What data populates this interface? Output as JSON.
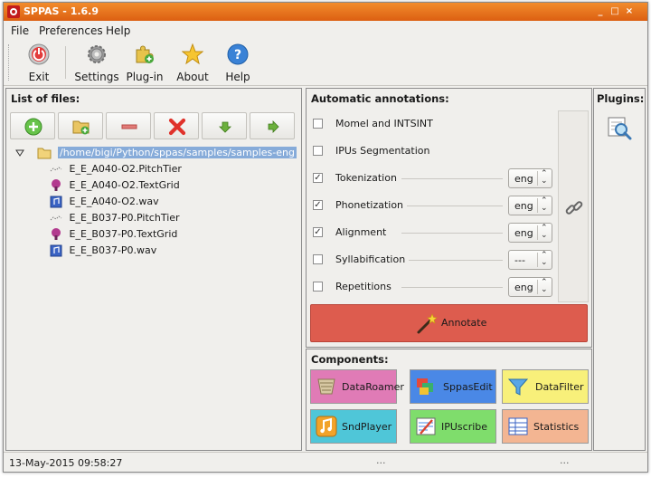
{
  "window": {
    "title": "SPPAS - 1.6.9"
  },
  "titlebar_buttons": {
    "minimize": "_",
    "maximize": "□",
    "close": "×"
  },
  "menu": {
    "file": "File",
    "preferences": "Preferences",
    "help": "Help"
  },
  "toolbar": {
    "exit": "Exit",
    "settings": "Settings",
    "plugin": "Plug-in",
    "about": "About",
    "help": "Help"
  },
  "files": {
    "title": "List of files:",
    "root": "/home/bigi/Python/sppas/samples/samples-eng",
    "items": [
      {
        "name": "E_E_A040-O2.PitchTier",
        "icon": "pitchtier-icon"
      },
      {
        "name": "E_E_A040-O2.TextGrid",
        "icon": "textgrid-icon"
      },
      {
        "name": "E_E_A040-O2.wav",
        "icon": "wav-icon"
      },
      {
        "name": "E_E_B037-P0.PitchTier",
        "icon": "pitchtier-icon"
      },
      {
        "name": "E_E_B037-P0.TextGrid",
        "icon": "textgrid-icon"
      },
      {
        "name": "E_E_B037-P0.wav",
        "icon": "wav-icon"
      }
    ]
  },
  "annotations": {
    "title": "Automatic annotations:",
    "items": [
      {
        "label": "Momel and INTSINT",
        "checked": false,
        "lang": null
      },
      {
        "label": "IPUs Segmentation",
        "checked": false,
        "lang": null
      },
      {
        "label": "Tokenization",
        "checked": true,
        "lang": "eng"
      },
      {
        "label": "Phonetization",
        "checked": true,
        "lang": "eng"
      },
      {
        "label": "Alignment",
        "checked": true,
        "lang": "eng"
      },
      {
        "label": "Syllabification",
        "checked": false,
        "lang": "---"
      },
      {
        "label": "Repetitions",
        "checked": false,
        "lang": "eng"
      }
    ],
    "annotate_label": "Annotate"
  },
  "components": {
    "title": "Components:",
    "items": [
      {
        "label": "DataRoamer",
        "color": "#e07bb6"
      },
      {
        "label": "SppasEdit",
        "color": "#4a88e6"
      },
      {
        "label": "DataFilter",
        "color": "#f8f07a"
      },
      {
        "label": "SndPlayer",
        "color": "#4fc6d8"
      },
      {
        "label": "IPUscribe",
        "color": "#7fdd6c"
      },
      {
        "label": "Statistics",
        "color": "#f3b592"
      }
    ]
  },
  "plugins": {
    "title": "Plugins:"
  },
  "status": {
    "datetime": "13-May-2015 09:58:27",
    "dots1": "...",
    "dots2": "..."
  },
  "colors": {
    "titlebar": "#e87520",
    "selection": "#86abd9",
    "annotate": "#dd5c4e"
  }
}
